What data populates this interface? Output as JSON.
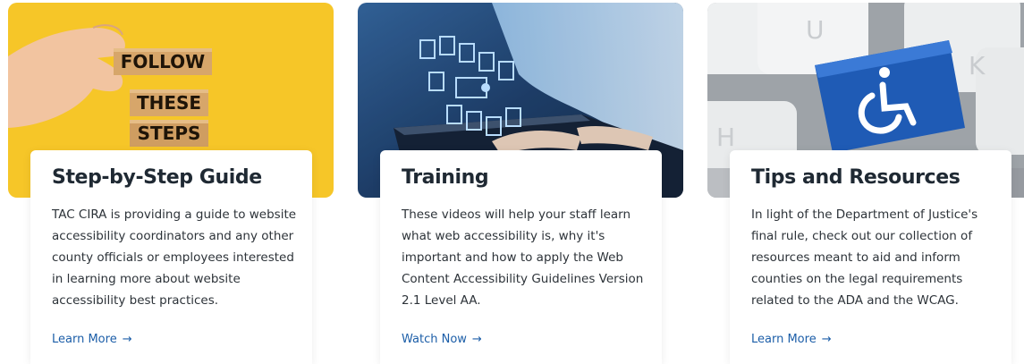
{
  "cards": [
    {
      "image_text": [
        "FOLLOW",
        "THESE",
        "STEPS"
      ],
      "title": "Step-by-Step Guide",
      "body": "TAC CIRA is providing a guide to website accessibility coordinators and any other county officials or employees interested in learning more about website accessibility best practices.",
      "link": "Learn More",
      "arrow": "→"
    },
    {
      "title": "Training",
      "body": "These videos will help your staff learn what web accessibility is, why it's important and how to apply the Web Content Accessibility Guidelines Version 2.1 Level AA.",
      "link": "Watch Now",
      "arrow": "→"
    },
    {
      "image_text": [
        "U",
        "K",
        "H"
      ],
      "title": "Tips and Resources",
      "body": "In light of the Department of Justice's final rule, check out our collection of resources meant to aid and inform counties on the legal requirements related to the ADA and the WCAG.",
      "link": "Learn More",
      "arrow": "→"
    }
  ],
  "colors": {
    "link": "#1c5ea8",
    "card1_bg": "#f6c21c",
    "card2_bg": "#17345c",
    "card3_key": "#1f5bb5"
  },
  "icons": [
    "hand-icon",
    "document-icons",
    "wheelchair-icon",
    "arrow-right-icon"
  ]
}
